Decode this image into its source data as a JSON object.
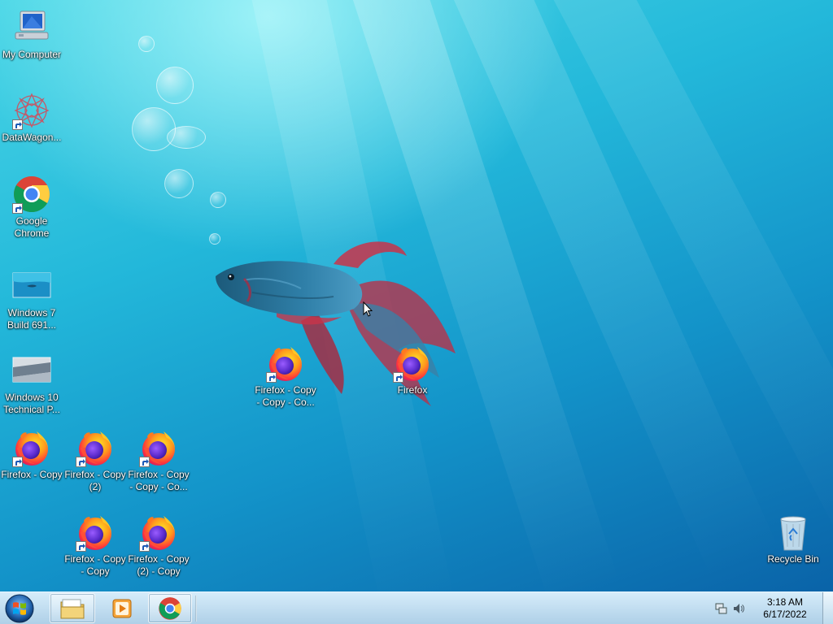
{
  "desktop": {
    "icons": {
      "my_computer": "My Computer",
      "datawagon": "DataWagon...",
      "chrome_line1": "Google",
      "chrome_line2": "Chrome",
      "win7_line1": "Windows 7",
      "win7_line2": "Build 691...",
      "win10_line1": "Windows 10",
      "win10_line2": "Technical P...",
      "ff_copy": "Firefox - Copy",
      "ff_copy2_line1": "Firefox - Copy",
      "ff_copy2_line2": "(2)",
      "ff_ccc_line1": "Firefox - Copy",
      "ff_ccc_line2": "- Copy - Co...",
      "ff_cc_line1": "Firefox - Copy",
      "ff_cc_line2": "- Copy",
      "ff_2c_line1": "Firefox - Copy",
      "ff_2c_line2": "(2) - Copy",
      "ff_mid_line1": "Firefox - Copy",
      "ff_mid_line2": "- Copy - Co...",
      "firefox": "Firefox",
      "recycle_bin": "Recycle Bin"
    },
    "icon_names": [
      "computer-icon",
      "datawagon-icon",
      "chrome-icon",
      "image-thumbnail-icon",
      "firefox-icon",
      "recycle-bin-icon"
    ]
  },
  "taskbar": {
    "pinned": [
      "file-explorer-icon",
      "media-player-icon",
      "chrome-icon"
    ],
    "clock": {
      "time": "3:18 AM",
      "date": "6/17/2022"
    },
    "colors": {
      "taskbar": "#b8d6ea",
      "desktop_accent": "#23b8da"
    }
  }
}
